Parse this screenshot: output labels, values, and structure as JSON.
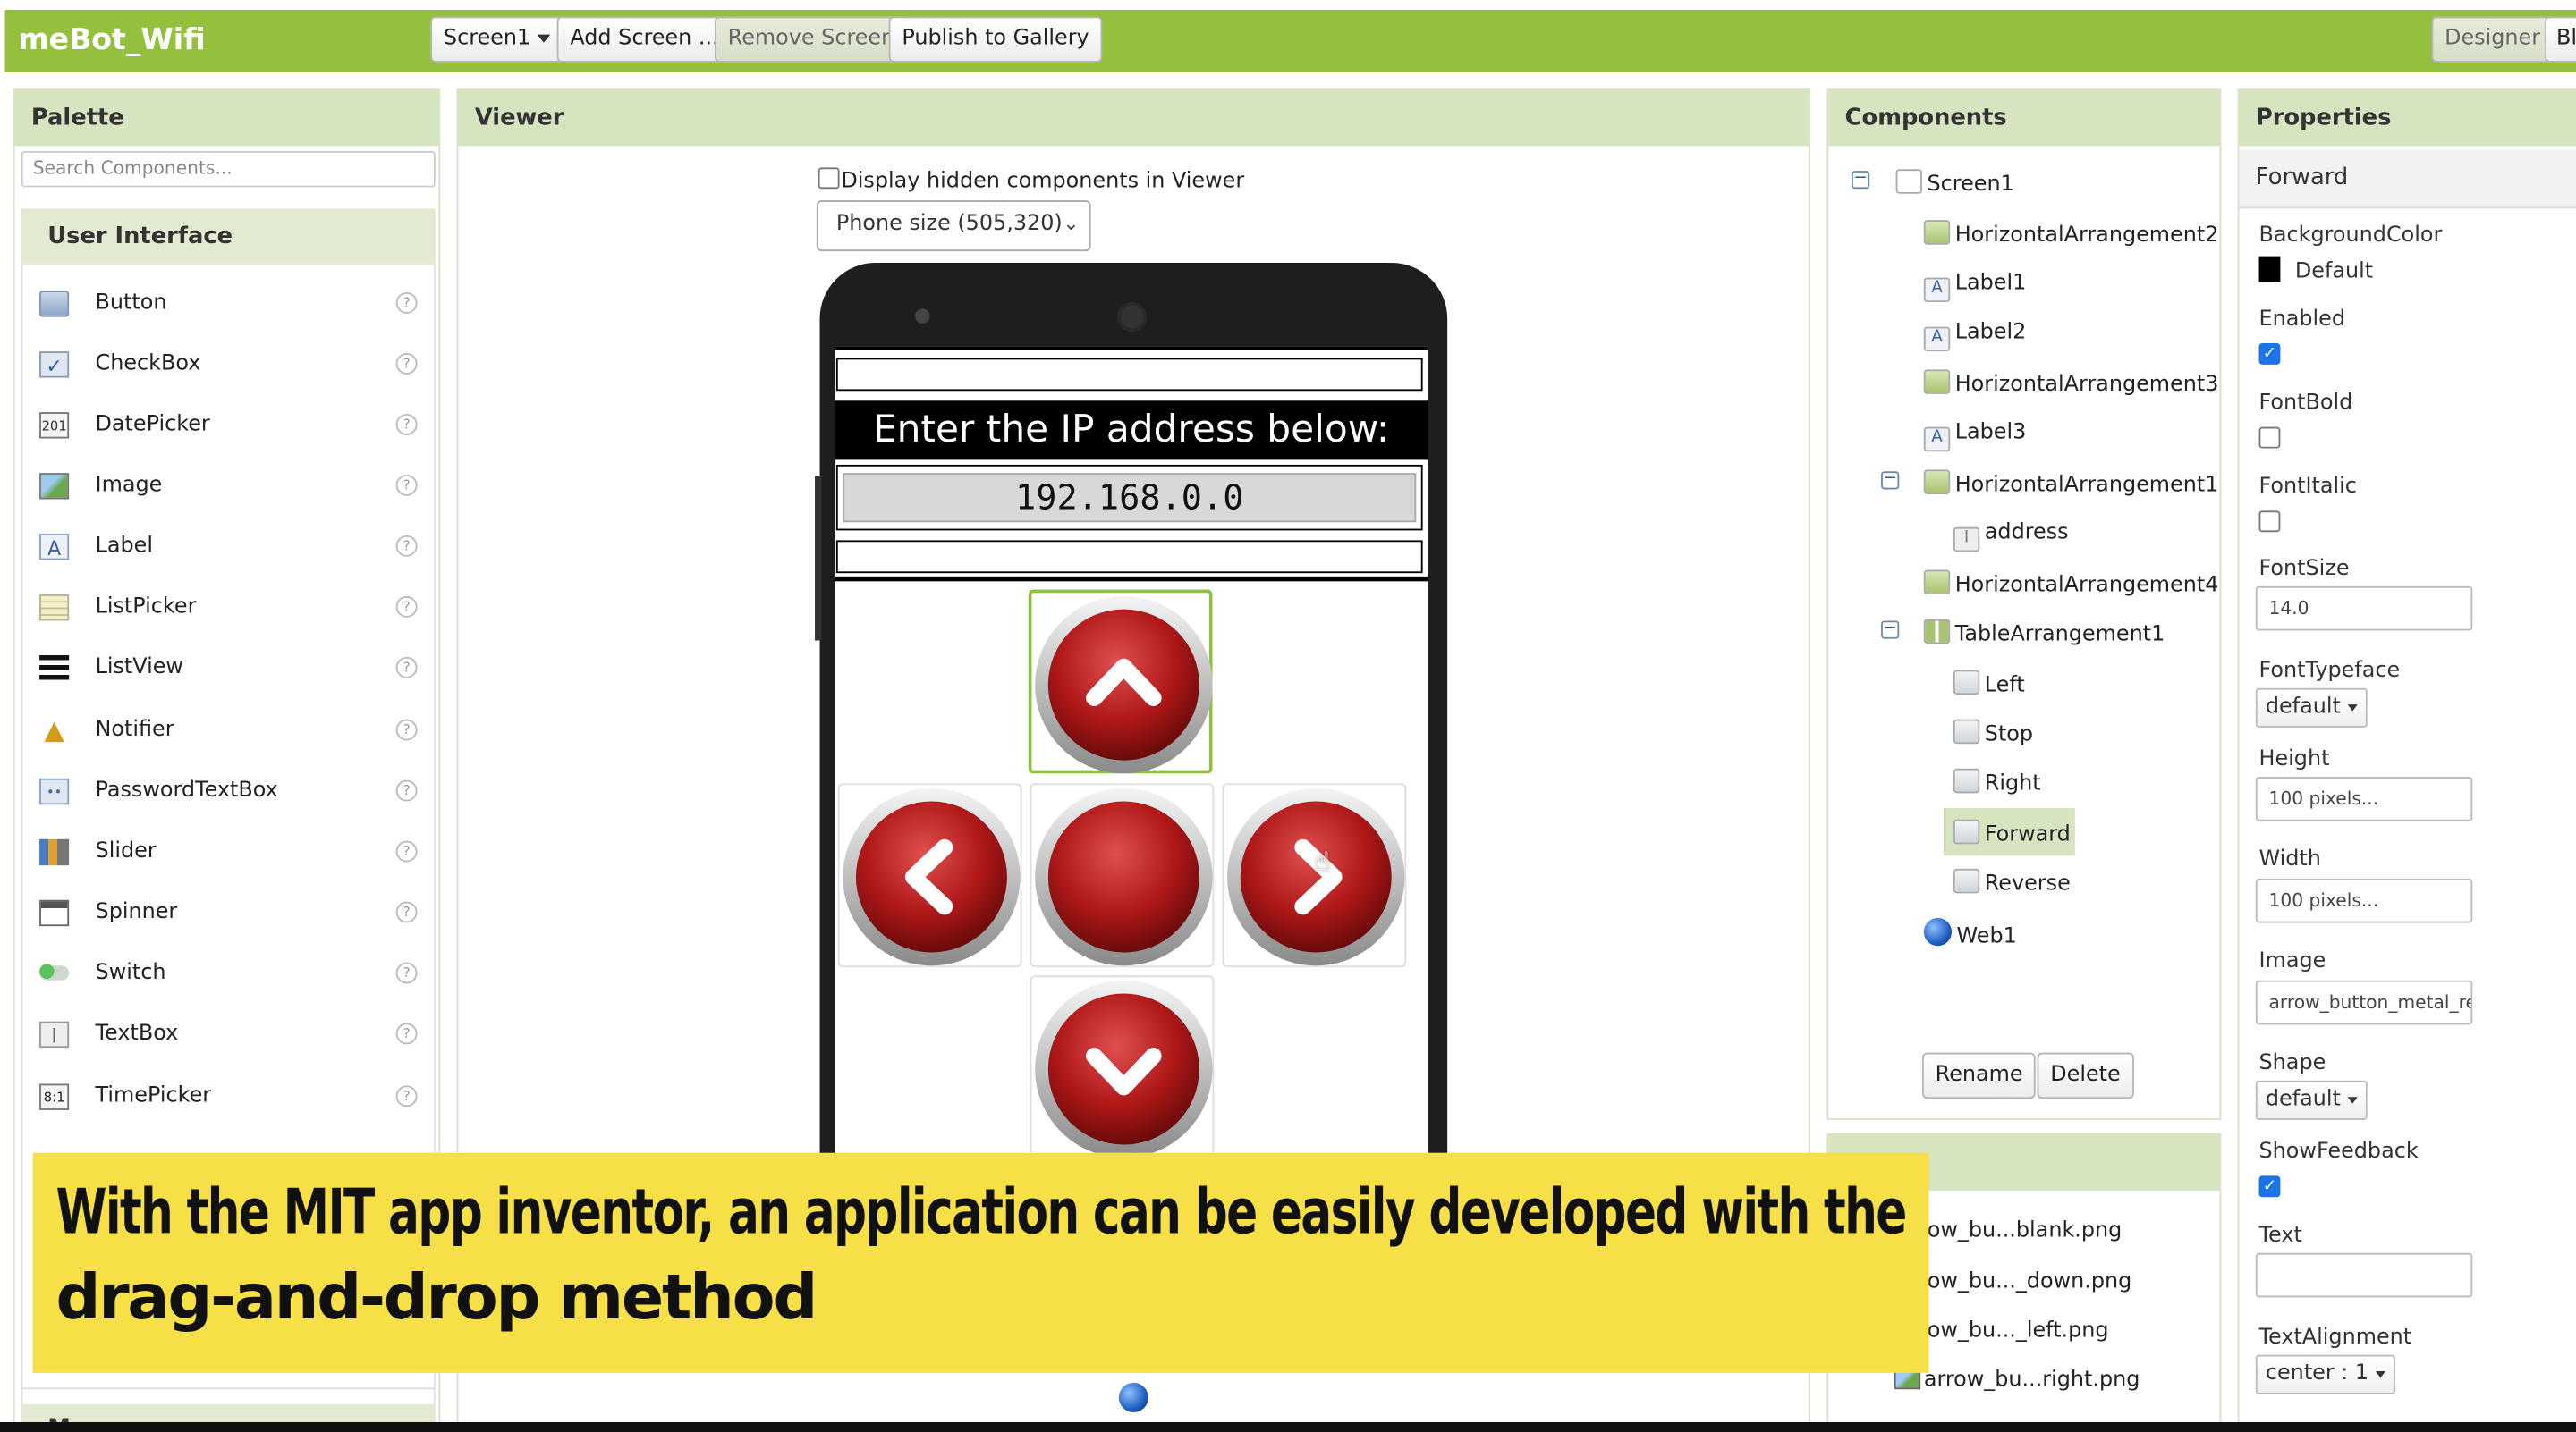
{
  "app": {
    "title": "meBot_Wifi"
  },
  "toolbar": {
    "screen_select": "Screen1",
    "add_screen": "Add Screen ...",
    "remove_screen": "Remove Screen",
    "publish": "Publish to Gallery",
    "designer": "Designer",
    "blocks": "Bl"
  },
  "palette": {
    "title": "Palette",
    "search_placeholder": "Search Components...",
    "category": "User Interface",
    "items": [
      {
        "label": "Button",
        "icon": "button-icon"
      },
      {
        "label": "CheckBox",
        "icon": "checkbox-icon"
      },
      {
        "label": "DatePicker",
        "icon": "datepicker-icon"
      },
      {
        "label": "Image",
        "icon": "image-icon"
      },
      {
        "label": "Label",
        "icon": "label-icon"
      },
      {
        "label": "ListPicker",
        "icon": "listpicker-icon"
      },
      {
        "label": "ListView",
        "icon": "listview-icon"
      },
      {
        "label": "Notifier",
        "icon": "notifier-icon"
      },
      {
        "label": "PasswordTextBox",
        "icon": "password-icon"
      },
      {
        "label": "Slider",
        "icon": "slider-icon"
      },
      {
        "label": "Spinner",
        "icon": "spinner-icon"
      },
      {
        "label": "Switch",
        "icon": "switch-icon"
      },
      {
        "label": "TextBox",
        "icon": "textbox-icon"
      },
      {
        "label": "TimePicker",
        "icon": "timepicker-icon"
      }
    ],
    "bottom_category": "Maps"
  },
  "viewer": {
    "title": "Viewer",
    "hidden_checkbox_label": "Display hidden components in Viewer",
    "phone_size": "Phone size (505,320)",
    "app_header": "Enter the IP address below:",
    "ip_value": "192.168.0.0"
  },
  "components": {
    "title": "Components",
    "tree": [
      {
        "label": "Screen1"
      },
      {
        "label": "HorizontalArrangement2"
      },
      {
        "label": "Label1"
      },
      {
        "label": "Label2"
      },
      {
        "label": "HorizontalArrangement3"
      },
      {
        "label": "Label3"
      },
      {
        "label": "HorizontalArrangement1"
      },
      {
        "label": "address"
      },
      {
        "label": "HorizontalArrangement4"
      },
      {
        "label": "TableArrangement1"
      },
      {
        "label": "Left"
      },
      {
        "label": "Stop"
      },
      {
        "label": "Right"
      },
      {
        "label": "Forward"
      },
      {
        "label": "Reverse"
      },
      {
        "label": "Web1"
      }
    ],
    "rename": "Rename",
    "delete": "Delete",
    "media": [
      "arrow_bu...blank.png",
      "arrow_bu..._down.png",
      "arrow_bu..._left.png",
      "arrow_bu...right.png"
    ]
  },
  "properties": {
    "title": "Properties",
    "selected": "Forward",
    "background_color_label": "BackgroundColor",
    "background_color_value": "Default",
    "enabled_label": "Enabled",
    "fontbold_label": "FontBold",
    "fontitalic_label": "FontItalic",
    "fontsize_label": "FontSize",
    "fontsize_value": "14.0",
    "fonttypeface_label": "FontTypeface",
    "fonttypeface_value": "default",
    "height_label": "Height",
    "height_value": "100 pixels...",
    "width_label": "Width",
    "width_value": "100 pixels...",
    "image_label": "Image",
    "image_value": "arrow_button_metal_re",
    "shape_label": "Shape",
    "shape_value": "default",
    "showfeedback_label": "ShowFeedback",
    "text_label": "Text",
    "text_value": "",
    "textalignment_label": "TextAlignment",
    "textalignment_value": "center : 1"
  },
  "caption": {
    "line1": "With the MIT app inventor, an application can be easily developed with the",
    "line2": "drag-and-drop method"
  },
  "colors": {
    "topbar": "#95c03d",
    "panel_header": "#d6e4bf",
    "caption_bg": "#f7e047",
    "button_red": "#c0231f"
  }
}
